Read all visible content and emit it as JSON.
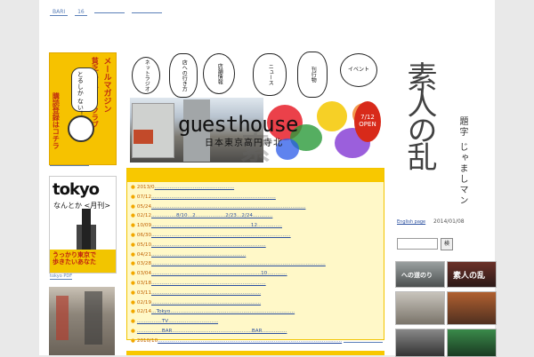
{
  "top_links": [
    "BARI",
    "16",
    "",
    ""
  ],
  "left_column": {
    "banner1": {
      "vertical_text_1": "メールマガジン",
      "vertical_text_2": "貧乏人ファイトクラブ",
      "vertical_text_3": "とるしか ない！",
      "bottom_text": "購読登録はコチラ"
    },
    "banner1_link": "",
    "banner2": {
      "title": "tokyo",
      "subtitle": "なんとか <月刊>",
      "footer_line1": "うっかり東京で",
      "footer_line2": "歩きたいあなた"
    },
    "banner2_link": "tokyo  PDF"
  },
  "header": {
    "bubbles": [
      "ネットラジオ",
      "店への行き方",
      "店舗情報",
      "ニュース",
      "刊行物",
      "イベント"
    ],
    "title": "guesthouse",
    "subtitle": "日本東京高円寺北",
    "open_badge_date": "7/12",
    "open_badge_label": "OPEN"
  },
  "news": {
    "items": [
      {
        "date": "2013/0",
        "text": "…………………………………………"
      },
      {
        "date": "07/12",
        "text": "…………………………………………………………………"
      },
      {
        "date": "05/24",
        "text": "…………………………………………………………………………………"
      },
      {
        "date": "02/12",
        "text": "……………8/10…2………………2/23…2/24…………"
      },
      {
        "date": "10/09",
        "text": "……………………………………………………12……………"
      },
      {
        "date": "06/30",
        "text": "…………………………………………………………………………"
      },
      {
        "date": "05/10",
        "text": "……………………………………………………………"
      },
      {
        "date": "04/21",
        "text": "…………………………………………………"
      },
      {
        "date": "03/28",
        "text": "……………………………………………………………………………………………"
      },
      {
        "date": "03/04",
        "text": "…………………………………………………………10…………"
      },
      {
        "date": "03/18",
        "text": "……………………………………………………………"
      },
      {
        "date": "03/11",
        "text": "…………………………………………………………"
      },
      {
        "date": "02/19",
        "text": "…………………………………………………………"
      },
      {
        "date": "02/14",
        "text": "…Tokyo…………………………………………………………………"
      },
      {
        "date": "",
        "text": "……………TV…………………………"
      },
      {
        "date": "",
        "text": "……………BAR…………………………………………BAR……………"
      },
      {
        "date": "2010/10",
        "text": "…………………………………………………………………………………………………"
      }
    ]
  },
  "right_column": {
    "calligraphy": "素人の乱",
    "author": "題字 じゃましマン",
    "english_link": "English page",
    "date": "2014/01/08",
    "search_button": "検",
    "thumb1_label": "への道のり",
    "thumb2_label": "素人の乱"
  },
  "colors": {
    "accent_yellow": "#f8c800",
    "news_bg": "#fff8c8",
    "link_blue": "#2a4f9f",
    "badge_red": "#d82a1a"
  }
}
